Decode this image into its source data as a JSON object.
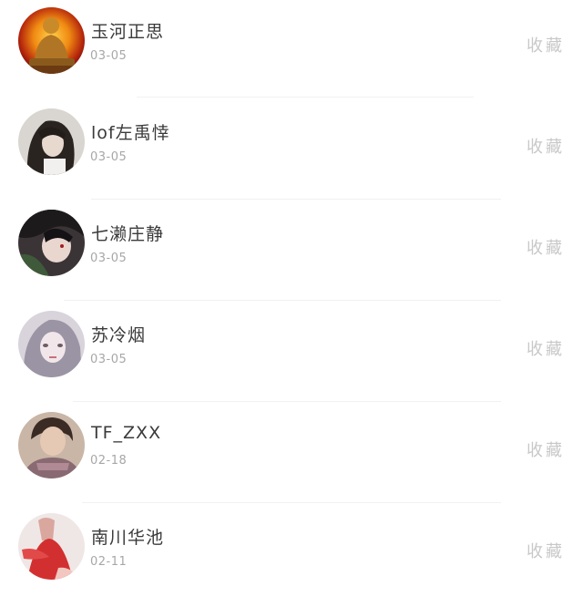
{
  "users": [
    {
      "name": "玉河正思",
      "date": "03-05",
      "action_label": "收藏"
    },
    {
      "name": "lof左禹悻",
      "date": "03-05",
      "action_label": "收藏"
    },
    {
      "name": "七濑庄静",
      "date": "03-05",
      "action_label": "收藏"
    },
    {
      "name": "苏冷烟",
      "date": "03-05",
      "action_label": "收藏"
    },
    {
      "name": "TF_ZXX",
      "date": "02-18",
      "action_label": "收藏"
    },
    {
      "name": "南川华池",
      "date": "02-11",
      "action_label": "收藏"
    }
  ]
}
